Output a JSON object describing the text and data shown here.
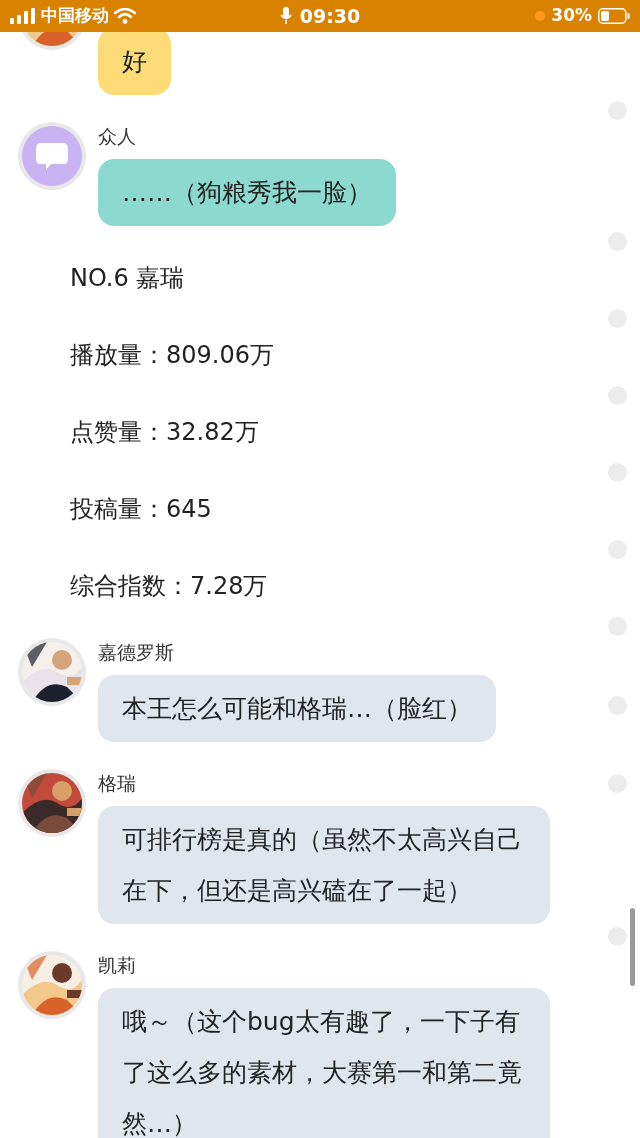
{
  "status_bar": {
    "carrier": "中国移动",
    "time": "09:30",
    "battery": "30%"
  },
  "messages": [
    {
      "kind": "message",
      "color": "#fddc78",
      "text": "好"
    },
    {
      "kind": "message",
      "avatar": {
        "kind": "icon"
      },
      "name": "众人",
      "color": "#8cd9cf",
      "text": "……（狗粮秀我一脸）"
    },
    {
      "kind": "narration",
      "text": "NO.6 嘉瑞"
    },
    {
      "kind": "narration",
      "text": "播放量：809.06万"
    },
    {
      "kind": "narration",
      "text": "点赞量：32.82万"
    },
    {
      "kind": "narration",
      "text": "投稿量：645"
    },
    {
      "kind": "narration",
      "text": "综合指数：7.28万"
    },
    {
      "kind": "message",
      "name": "嘉德罗斯",
      "color": "#dfe6ee",
      "text": "本王怎么可能和格瑞…（脸红）"
    },
    {
      "kind": "message",
      "name": "格瑞",
      "color": "#dfe6ee",
      "text": "可排行榜是真的（虽然不太高兴自己在下，但还是高兴磕在了一起）"
    },
    {
      "kind": "message",
      "name": "凯莉",
      "color": "#dfe6ee",
      "text": "哦～（这个bug太有趣了，一下子有了这么多的素材，大赛第一和第二竟然…）"
    }
  ]
}
